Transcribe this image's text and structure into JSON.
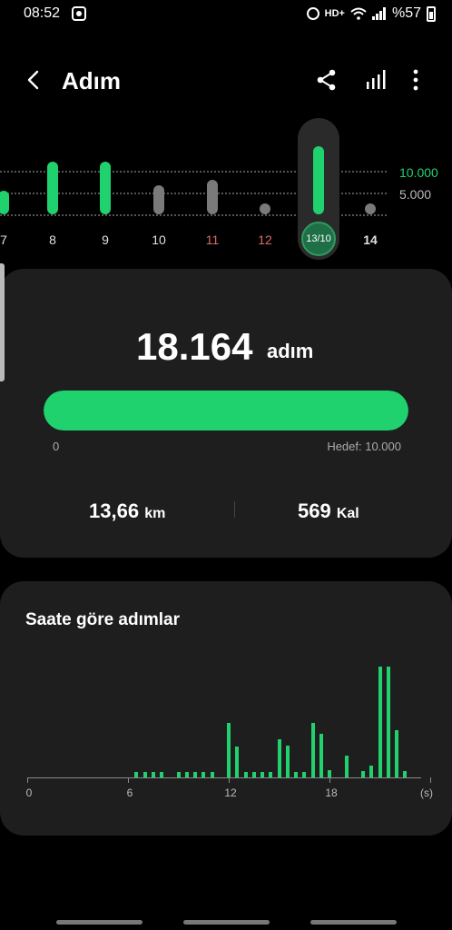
{
  "status_bar": {
    "time": "08:52",
    "network_label": "HD+",
    "battery_text": "%57",
    "icons": [
      "screenshot-icon",
      "alarm-icon",
      "wifi-icon",
      "signal-icon",
      "battery-icon"
    ]
  },
  "header": {
    "title": "Adım",
    "icons": [
      "back-icon",
      "share-icon",
      "stats-icon",
      "more-icon"
    ]
  },
  "daily_chart": {
    "goal_labels": [
      "10.000",
      "5.000"
    ],
    "days": [
      {
        "label": "7",
        "type": "green",
        "level": 0.45
      },
      {
        "label": "8",
        "type": "green",
        "level": 1.0
      },
      {
        "label": "9",
        "type": "green",
        "level": 1.0
      },
      {
        "label": "10",
        "type": "gray",
        "level": 0.55
      },
      {
        "label": "11",
        "type": "gray",
        "level": 0.65,
        "color": "#e06a6a"
      },
      {
        "label": "12",
        "type": "dot",
        "level": 0,
        "color": "#e06a6a"
      },
      {
        "label": "13/10",
        "type": "green",
        "level": 1.3,
        "selected": true
      },
      {
        "label": "14",
        "type": "dot",
        "level": 0
      }
    ]
  },
  "summary": {
    "steps": "18.164",
    "steps_unit": "adım",
    "progress_fraction": 1.0,
    "progress_min": "0",
    "progress_goal": "Hedef: 10.000",
    "distance_value": "13,66",
    "distance_unit": "km",
    "calories_value": "569",
    "calories_unit": "Kal"
  },
  "hourly": {
    "title": "Saate göre adımlar",
    "axis_labels": [
      "0",
      "6",
      "12",
      "18",
      "(s)"
    ],
    "bars": [
      {
        "hour": 6.5,
        "v": 0.04
      },
      {
        "hour": 7.0,
        "v": 0.04
      },
      {
        "hour": 7.5,
        "v": 0.04
      },
      {
        "hour": 8.0,
        "v": 0.04
      },
      {
        "hour": 9.0,
        "v": 0.04
      },
      {
        "hour": 9.5,
        "v": 0.04
      },
      {
        "hour": 10.0,
        "v": 0.04
      },
      {
        "hour": 10.5,
        "v": 0.04
      },
      {
        "hour": 11.0,
        "v": 0.04
      },
      {
        "hour": 12.0,
        "v": 0.43
      },
      {
        "hour": 12.5,
        "v": 0.24
      },
      {
        "hour": 13.0,
        "v": 0.04
      },
      {
        "hour": 13.5,
        "v": 0.04
      },
      {
        "hour": 14.0,
        "v": 0.04
      },
      {
        "hour": 14.5,
        "v": 0.04
      },
      {
        "hour": 15.0,
        "v": 0.3
      },
      {
        "hour": 15.5,
        "v": 0.25
      },
      {
        "hour": 16.0,
        "v": 0.04
      },
      {
        "hour": 16.5,
        "v": 0.04
      },
      {
        "hour": 17.0,
        "v": 0.43
      },
      {
        "hour": 17.5,
        "v": 0.34
      },
      {
        "hour": 18.0,
        "v": 0.06
      },
      {
        "hour": 19.0,
        "v": 0.17
      },
      {
        "hour": 20.0,
        "v": 0.05
      },
      {
        "hour": 20.5,
        "v": 0.09
      },
      {
        "hour": 21.0,
        "v": 0.87
      },
      {
        "hour": 21.5,
        "v": 0.87
      },
      {
        "hour": 22.0,
        "v": 0.37
      },
      {
        "hour": 22.5,
        "v": 0.05
      }
    ]
  },
  "colors": {
    "accent": "#1fd26e",
    "bar_gray": "#7a7a7a",
    "weekend_red": "#e06a6a",
    "card_bg": "#1e1e1e"
  }
}
